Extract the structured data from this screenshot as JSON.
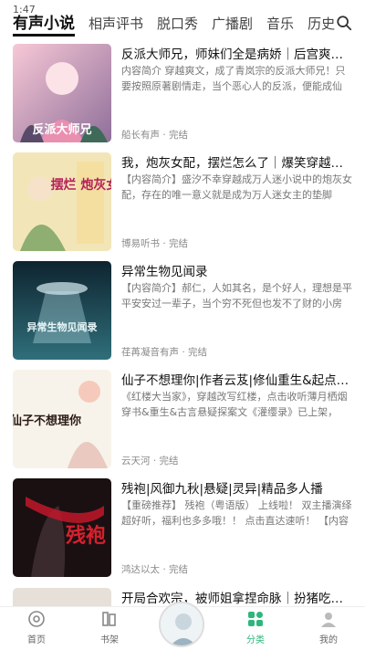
{
  "status": {
    "time": "1:47"
  },
  "tabs": [
    {
      "label": "有声小说",
      "active": true
    },
    {
      "label": "相声评书"
    },
    {
      "label": "脱口秀"
    },
    {
      "label": "广播剧"
    },
    {
      "label": "音乐"
    },
    {
      "label": "历史"
    }
  ],
  "items": [
    {
      "title": "反派大师兄，师妹们全是病娇｜后宫爽文｜...",
      "desc": "内容简介 穿越爽文，成了青岚宗的反派大师兄！只要按照原著剧情走，当个恶心人的反派，便能成仙飞...",
      "meta": "船长有声 · 完结",
      "cover_text": "反派大师兄"
    },
    {
      "title": "我，炮灰女配，摆烂怎么了｜爆笑穿越｜团...",
      "desc": "【内容简介】盛汐不幸穿越成万人迷小说中的炮灰女配，存在的唯一意义就是成为万人迷女主的垫脚石！...",
      "meta": "博易听书 · 完结",
      "cover_text": "摆烂 炮灰女配"
    },
    {
      "title": "异常生物见闻录",
      "desc": "【内容简介】郝仁，人如其名，是个好人，理想是平平安安过一辈子，当个穷不死但也发不了财的小房东...",
      "meta": "荏苒凝音有声 · 完结",
      "cover_text": "异常生物见闻录"
    },
    {
      "title": "仙子不想理你|作者云芨|修仙重生&起点爆款...",
      "desc": "《红楼大当家》，穿越改写红楼，点击收听薄月栖烟穿书&重生&古言悬疑探案文《灌缨录》已上架，点...",
      "meta": "云天河 · 完结",
      "cover_text": "仙子不想理你"
    },
    {
      "title": "残袍|风御九秋|悬疑|灵异|精品多人播",
      "desc": "【重磅推荐】 残袍（粤语版） 上线啦！ 双主播演绎超好听，福利也多多哦！！ 点击直达速听！ 【内容简...",
      "meta": "鸿达以太 · 完结",
      "cover_text": "残袍"
    }
  ],
  "partial_item": {
    "title": "开局合欢宗，被师姐拿捏命脉｜扮猪吃虎｜法..."
  },
  "bottom_nav": [
    {
      "label": "首页",
      "icon": "home-disc-icon"
    },
    {
      "label": "书架",
      "icon": "bookshelf-icon"
    },
    {
      "label": "",
      "icon": "now-playing-disc"
    },
    {
      "label": "分类",
      "icon": "category-grid-icon",
      "active": true
    },
    {
      "label": "我的",
      "icon": "profile-icon"
    }
  ],
  "colors": {
    "accent": "#2fb67c"
  }
}
